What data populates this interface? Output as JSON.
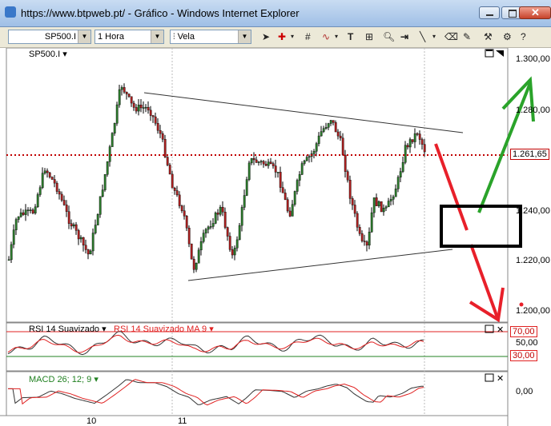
{
  "window": {
    "title": "https://www.btpweb.pt/ - Gráfico - Windows Internet Explorer"
  },
  "toolbar": {
    "symbol": "SP500.I",
    "interval": "1 Hora",
    "chart_style": "Vela"
  },
  "main_pane": {
    "symbol_label": "SP500.I",
    "price_axis": [
      "1.300,00",
      "1.280,00",
      "1.261,65",
      "1.240,00",
      "1.220,00",
      "1.200,00"
    ],
    "current_price": "1.261,65"
  },
  "rsi_pane": {
    "label": "RSI 14 Suavizado",
    "ma_label": "RSI 14 Suavizado MA 9",
    "levels": [
      "70,00",
      "50,00",
      "30,00"
    ],
    "colors": {
      "upper": "#e02020",
      "lower": "#208020"
    }
  },
  "macd_pane": {
    "label": "MACD 26; 12; 9",
    "axis": [
      "0,00"
    ]
  },
  "time_axis": [
    "10",
    "11"
  ],
  "colors": {
    "annotation_red": "#e8202a",
    "annotation_green": "#2aa32a",
    "titlebar": "#a8c4e8"
  },
  "icons": [
    "back-icon",
    "close-icon",
    "crosshair-icon",
    "grid-icon",
    "indicator-icon",
    "text-icon",
    "zoom-icon",
    "line-icon",
    "eraser-icon",
    "pencil-icon",
    "tools-icon",
    "help-icon"
  ]
}
